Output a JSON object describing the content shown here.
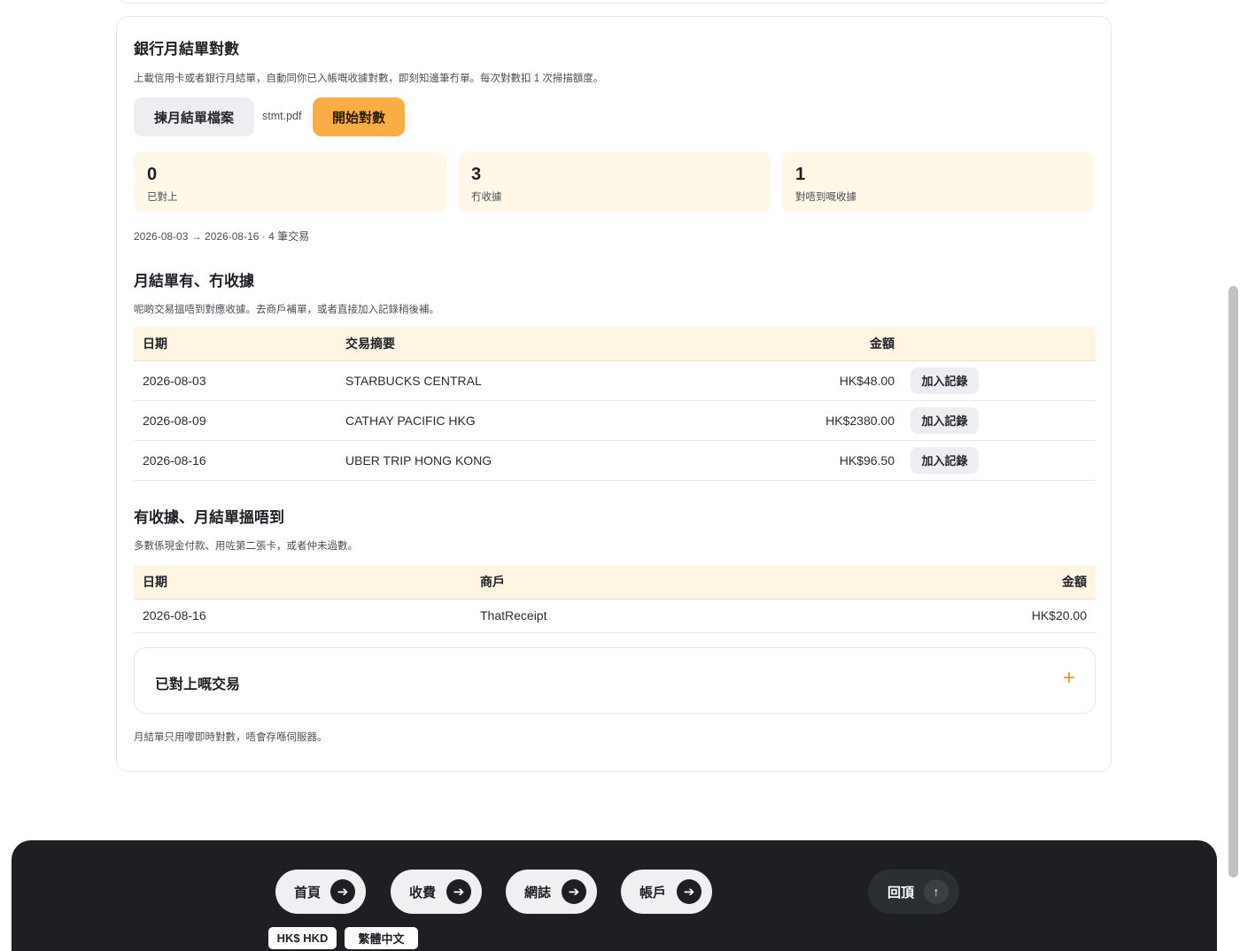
{
  "statement": {
    "title": "銀行月結單對數",
    "description": "上載信用卡或者銀行月結單，自動同你已入帳嘅收據對數，即刻知邊筆冇單。每次對數扣 1 次掃描額度。",
    "pick_button": "揀月結單檔案",
    "file_name": "stmt.pdf",
    "start_button": "開始對數"
  },
  "stats": [
    {
      "value": "0",
      "label": "已對上"
    },
    {
      "value": "3",
      "label": "冇收據"
    },
    {
      "value": "1",
      "label": "對唔到嘅收據"
    }
  ],
  "range_text": "2026-08-03 → 2026-08-16 · 4 筆交易",
  "no_receipt": {
    "title": "月結單有、冇收據",
    "description": "呢啲交易搵唔到對應收據。去商戶補單，或者直接加入記錄稍後補。",
    "headers": [
      "日期",
      "交易摘要",
      "金額"
    ],
    "rows": [
      {
        "date": "2026-08-03",
        "desc": "STARBUCKS CENTRAL",
        "amount": "HK$48.00",
        "action": "加入記錄"
      },
      {
        "date": "2026-08-09",
        "desc": "CATHAY PACIFIC HKG",
        "amount": "HK$2380.00",
        "action": "加入記錄"
      },
      {
        "date": "2026-08-16",
        "desc": "UBER TRIP HONG KONG",
        "amount": "HK$96.50",
        "action": "加入記錄"
      }
    ]
  },
  "unmatched_receipts": {
    "title": "有收據、月結單搵唔到",
    "description": "多數係現金付款、用咗第二張卡，或者仲未過數。",
    "headers": [
      "日期",
      "商戶",
      "金額"
    ],
    "rows": [
      {
        "date": "2026-08-16",
        "merchant": "ThatReceipt",
        "amount": "HK$20.00"
      }
    ]
  },
  "matched": {
    "title": "已對上嘅交易",
    "toggle": "+"
  },
  "note": "月結單只用嚟即時對數，唔會存喺伺服器。",
  "footer": {
    "nav": [
      {
        "label": "首頁",
        "icon": "arrow-right-icon"
      },
      {
        "label": "收費",
        "icon": "arrow-right-icon"
      },
      {
        "label": "網誌",
        "icon": "arrow-right-icon"
      },
      {
        "label": "帳戶",
        "icon": "arrow-right-icon"
      }
    ],
    "back_to_top": "回頂",
    "currency": "HK$ HKD",
    "language": "繁體中文"
  },
  "colors": {
    "accent": "#f8ad45",
    "stat_bg": "#fff7e8",
    "table_header_bg": "#fff5e2",
    "footer_bg": "#1d1f22"
  }
}
